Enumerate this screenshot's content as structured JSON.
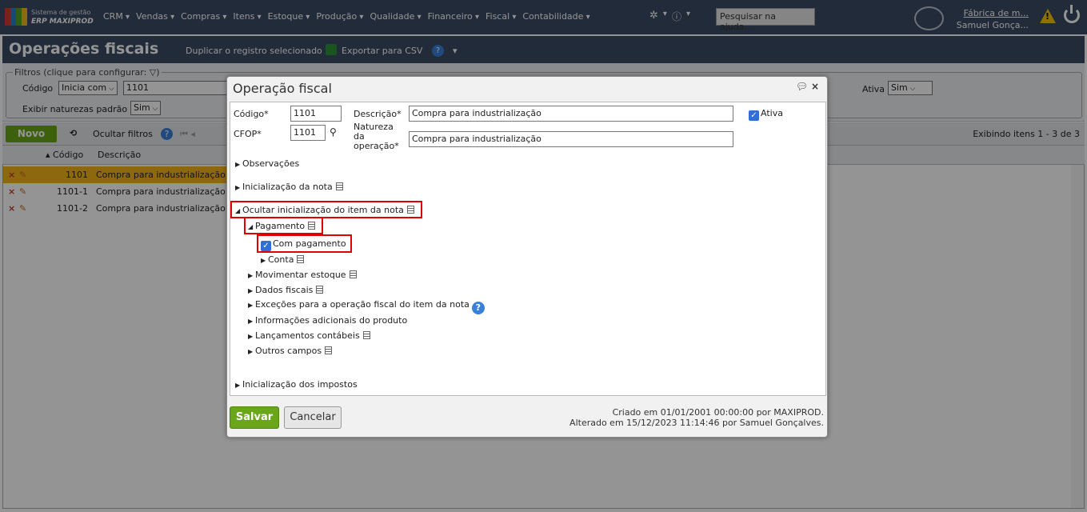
{
  "topbar": {
    "brand_line1": "Sistema de gestão",
    "brand_line2": "ERP MAXIPROD",
    "menu": [
      "CRM",
      "Vendas",
      "Compras",
      "Itens",
      "Estoque",
      "Produção",
      "Qualidade",
      "Financeiro",
      "Fiscal",
      "Contabilidade"
    ],
    "help_search_placeholder": "Pesquisar na ajuda...",
    "company": "Fábrica de m...",
    "user": "Samuel Gonça..."
  },
  "page": {
    "title": "Operações fiscais",
    "action_duplicate": "Duplicar o registro selecionado",
    "action_export": "Exportar para CSV"
  },
  "filters": {
    "legend": "Filtros (clique para configurar:",
    "codigo_label": "Código",
    "codigo_op": "Inicia com",
    "codigo_value": "1101",
    "naturezas_label": "Exibir naturezas padrão",
    "naturezas_value": "Sim",
    "ativa_label": "Ativa",
    "ativa_value": "Sim"
  },
  "toolbar": {
    "novo": "Novo",
    "hide_filters": "Ocultar filtros",
    "paging_info": "Exibindo itens 1 - 3 de 3"
  },
  "grid": {
    "columns": [
      "Código",
      "Descrição"
    ],
    "rows": [
      {
        "codigo": "1101",
        "descricao": "Compra para industrialização"
      },
      {
        "codigo": "1101-1",
        "descricao": "Compra para industrialização"
      },
      {
        "codigo": "1101-2",
        "descricao": "Compra para industrialização"
      }
    ]
  },
  "dialog": {
    "title": "Operação fiscal",
    "codigo_label": "Código*",
    "codigo_value": "1101",
    "cfop_label": "CFOP*",
    "cfop_value": "1101",
    "descricao_label": "Descrição*",
    "descricao_value": "Compra para industrialização",
    "natureza_label_1": "Natureza",
    "natureza_label_2": "da",
    "natureza_label_3": "operação*",
    "natureza_value": "Compra para industrialização",
    "ativa_label": "Ativa",
    "observacoes": "Observações",
    "inic_nota": "Inicialização da nota",
    "ocultar_item": "Ocultar inicialização do item da nota",
    "pagamento": "Pagamento",
    "com_pagamento": "Com pagamento",
    "conta": "Conta",
    "movimentar_estoque": "Movimentar estoque",
    "dados_fiscais": "Dados fiscais",
    "excecoes": "Exceções para a operação fiscal do item da nota",
    "info_adicionais": "Informações adicionais do produto",
    "lancamentos": "Lançamentos contábeis",
    "outros_campos": "Outros campos",
    "inic_impostos": "Inicialização dos impostos",
    "salvar": "Salvar",
    "cancelar": "Cancelar",
    "criado": "Criado em 01/01/2001 00:00:00 por MAXIPROD.",
    "alterado": "Alterado em 15/12/2023 11:14:46 por Samuel Gonçalves."
  }
}
